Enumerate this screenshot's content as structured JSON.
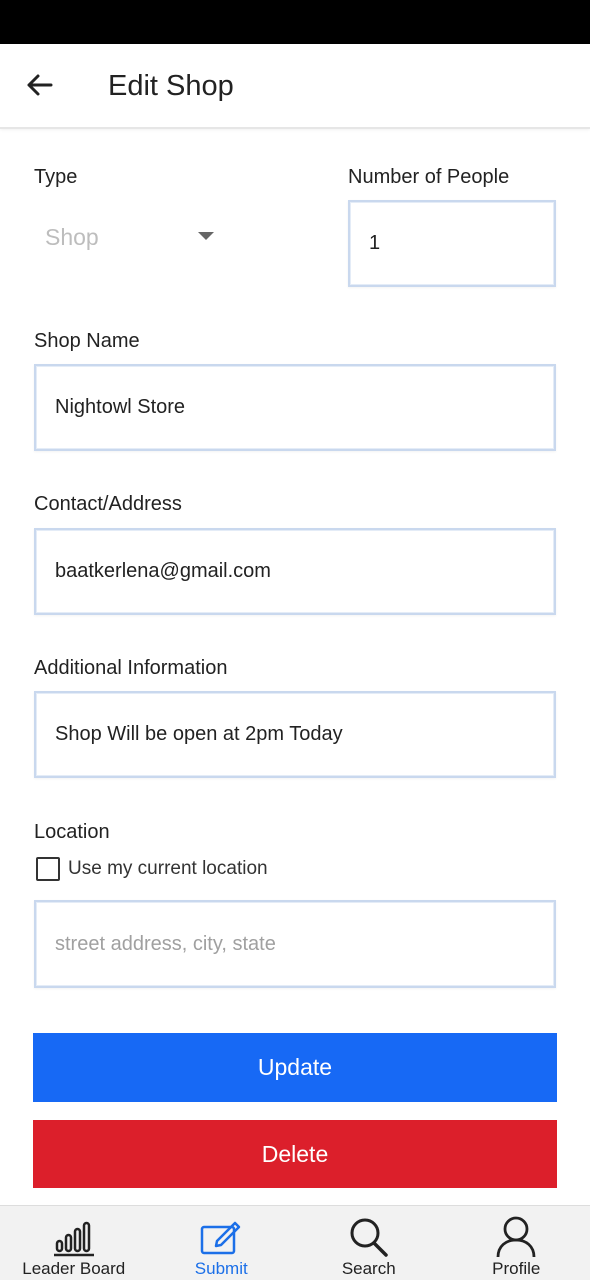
{
  "header": {
    "title": "Edit Shop",
    "back_icon": "arrow-left-icon"
  },
  "form": {
    "type_label": "Type",
    "type_value": "Shop",
    "people_label": "Number of People",
    "people_value": "1",
    "shop_name_label": "Shop Name",
    "shop_name_value": "Nightowl Store",
    "contact_label": "Contact/Address",
    "contact_value": "baatkerlena@gmail.com",
    "info_label": "Additional Information",
    "info_value": "Shop Will be open at 2pm Today",
    "location_label": "Location",
    "use_location_label": "Use my current location",
    "use_location_checked": false,
    "address_placeholder": "street address, city, state"
  },
  "buttons": {
    "update_label": "Update",
    "delete_label": "Delete"
  },
  "colors": {
    "update": "#1769f5",
    "delete": "#dc1f2b",
    "nav_active": "#1b6fe8"
  },
  "nav": {
    "items": [
      {
        "label": "Leader Board",
        "icon": "bar-chart-icon",
        "active": false
      },
      {
        "label": "Submit",
        "icon": "edit-icon",
        "active": true
      },
      {
        "label": "Search",
        "icon": "search-icon",
        "active": false
      },
      {
        "label": "Profile",
        "icon": "user-icon",
        "active": false
      }
    ]
  }
}
